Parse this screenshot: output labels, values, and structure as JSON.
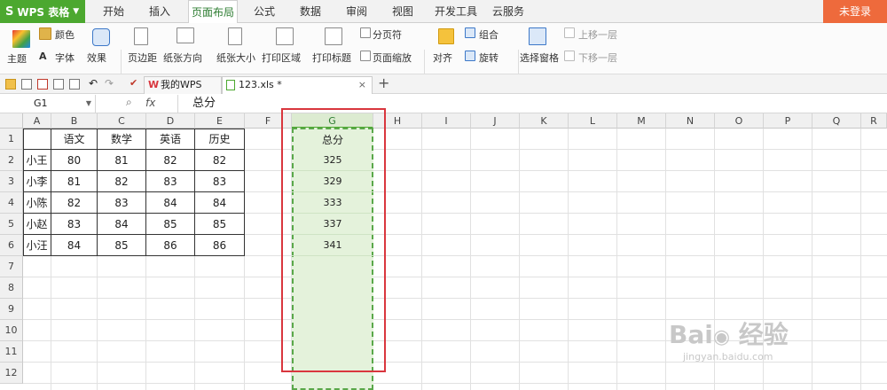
{
  "app": {
    "logo": "S",
    "name": "WPS 表格"
  },
  "menu": {
    "tabs": [
      "开始",
      "插入",
      "页面布局",
      "公式",
      "数据",
      "审阅",
      "视图",
      "开发工具",
      "云服务"
    ],
    "active": "页面布局",
    "login": "未登录"
  },
  "ribbon": {
    "theme": "主题",
    "color": "颜色",
    "font": "字体",
    "effect": "效果",
    "margins": "页边距",
    "orientation": "纸张方向",
    "size": "纸张大小",
    "print_area": "打印区域",
    "print_titles": "打印标题",
    "page_break": "分页符",
    "page_zoom": "页面缩放",
    "align": "对齐",
    "group": "组合",
    "rotate": "旋转",
    "select_pane": "选择窗格",
    "bring_forward": "上移一层",
    "send_backward": "下移一层"
  },
  "doc_tabs": [
    {
      "label": "我的WPS",
      "active": false
    },
    {
      "label": "123.xls *",
      "active": true
    }
  ],
  "formula_bar": {
    "cell_ref": "G1",
    "fx": "fx",
    "content": "总分"
  },
  "columns": [
    "A",
    "B",
    "C",
    "D",
    "E",
    "F",
    "G",
    "H",
    "I",
    "J",
    "K",
    "L",
    "M",
    "N",
    "O",
    "P",
    "Q",
    "R"
  ],
  "rows": [
    "1",
    "2",
    "3",
    "4",
    "5",
    "6",
    "7",
    "8",
    "9",
    "10",
    "11",
    "12"
  ],
  "table": {
    "headers": [
      "",
      "语文",
      "数学",
      "英语",
      "历史"
    ],
    "rows": [
      [
        "小王",
        "80",
        "81",
        "82",
        "82"
      ],
      [
        "小李",
        "81",
        "82",
        "83",
        "83"
      ],
      [
        "小陈",
        "82",
        "83",
        "84",
        "84"
      ],
      [
        "小赵",
        "83",
        "84",
        "85",
        "85"
      ],
      [
        "小汪",
        "84",
        "85",
        "86",
        "86"
      ]
    ]
  },
  "total_column": {
    "header": "总分",
    "values": [
      "325",
      "329",
      "333",
      "337",
      "341"
    ]
  },
  "watermark": "Bai 经验 jingyan.baidu.com",
  "colors": {
    "accent": "#4ca82f",
    "highlight_box": "#d9363e",
    "login": "#ee6a3c"
  }
}
